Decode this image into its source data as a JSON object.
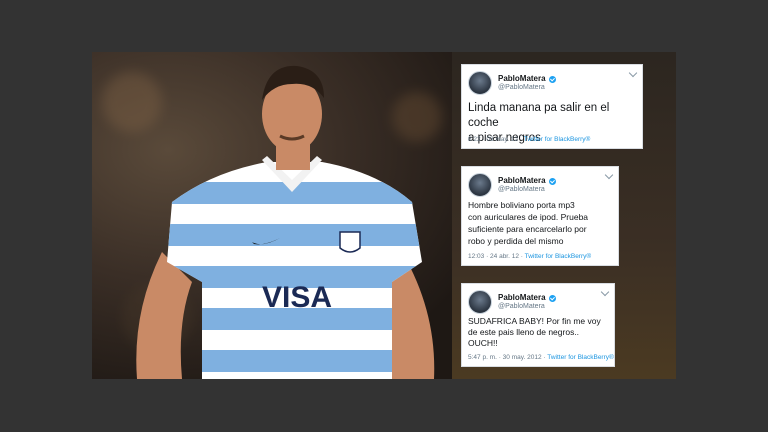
{
  "colors": {
    "page_background": "#333333",
    "tweet_background": "#ffffff",
    "verified_badge": "#1da1f2",
    "source_link": "#1b95e0",
    "jersey_stripe": "#7fb0e0"
  },
  "photo": {
    "jersey_sponsor": "VISA",
    "icons": [
      "rugby-player-photo",
      "nike-swoosh-icon",
      "uar-crest-icon"
    ]
  },
  "tweets": [
    {
      "name": "PabloMatera",
      "handle": "@PabloMatera",
      "text_lines": [
        "Linda manana pa salir en el coche",
        "a pisar negros"
      ],
      "timestamp": "8:22 · 03 may. 12 · ",
      "source": "Twitter for BlackBerry®"
    },
    {
      "name": "PabloMatera",
      "handle": "@PabloMatera",
      "text_lines": [
        "Hombre boliviano porta mp3",
        "con auriculares de ipod. Prueba",
        "suficiente para encarcelarlo por",
        "robo y perdida del mismo"
      ],
      "timestamp": "12:03 · 24 abr. 12 · ",
      "source": "Twitter for BlackBerry®"
    },
    {
      "name": "PabloMatera",
      "handle": "@PabloMatera",
      "text_lines": [
        "SUDAFRICA BABY! Por fin me voy",
        "de este pais lleno de negros..",
        "OUCH!!"
      ],
      "timestamp": "5:47 p. m. · 30 may. 2012 · ",
      "source": "Twitter for BlackBerry®"
    }
  ]
}
